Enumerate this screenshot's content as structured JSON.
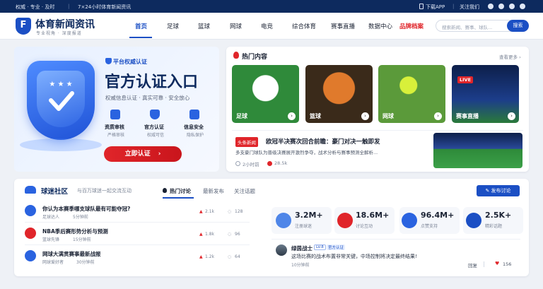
{
  "topbar": {
    "slogan": "权威 · 专业 · 及时",
    "news": "7×24小时体育新闻资讯",
    "download": "下载APP",
    "follow": "关注我们"
  },
  "brand": {
    "name": "体育新闻资讯",
    "tagline": "专业视角 · 深度报道",
    "logo_char": "F"
  },
  "nav": {
    "items": [
      "首页",
      "足球",
      "篮球",
      "网球",
      "电竞",
      "综合体育",
      "赛事直播",
      "数据中心",
      "品牌档案"
    ],
    "active_index": 0,
    "search_placeholder": "搜索新闻、赛事、球队...",
    "search_btn": "搜索"
  },
  "hero": {
    "tag": "平台权威认证",
    "title": "官方认证入口",
    "subtitle": "权威信息认证 · 真实可靠 · 安全放心",
    "features": [
      {
        "label": "资质审核",
        "sub": "严格审核"
      },
      {
        "label": "官方认证",
        "sub": "权威可信"
      },
      {
        "label": "信息安全",
        "sub": "隐私保护"
      }
    ],
    "cta": "立即认证",
    "cta_arrow": "›"
  },
  "hot": {
    "title": "热门内容",
    "more": "查看更多 ›",
    "tiles": [
      {
        "label": "足球",
        "color": "#2f8a3a"
      },
      {
        "label": "篮球",
        "color": "#b4551a"
      },
      {
        "label": "网球",
        "color": "#4c8f2a"
      },
      {
        "label": "赛事直播",
        "color": "#1c3d8a",
        "badge": "LIVE"
      }
    ],
    "headline": {
      "tag": "头条新闻",
      "title": "欧冠半决赛次回合前瞻：豪门对决一触即发",
      "summary": "多支豪门球队为晋级决赛展开激烈争夺，战术分析与赛事预测全解析...",
      "time": "2小时前",
      "views": "28.5k"
    }
  },
  "community": {
    "title": "球迷社区",
    "subtitle": "与百万球迷一起交流互动",
    "tabs": [
      "热门讨论",
      "最新发布",
      "关注话题"
    ],
    "active_tab": 0,
    "post_btn": "发布讨论",
    "topics": [
      {
        "title": "你认为本赛季哪支球队最有可能夺冠?",
        "author": "足球达人",
        "time": "5分钟前",
        "hot": "2.1k",
        "replies": "128",
        "color": "#2a63e0"
      },
      {
        "title": "NBA季后赛形势分析与预测",
        "author": "篮球先锋",
        "time": "15分钟前",
        "hot": "1.8k",
        "replies": "96",
        "color": "#e0252a"
      },
      {
        "title": "网球大满贯赛事最新战报",
        "author": "网球爱好者",
        "time": "30分钟前",
        "hot": "1.2k",
        "replies": "64",
        "color": "#2a63e0"
      }
    ],
    "stats": [
      {
        "value": "3.2M+",
        "label": "注册球迷",
        "color": "#4f86e8"
      },
      {
        "value": "18.6M+",
        "label": "讨论互动",
        "color": "#e0252a"
      },
      {
        "value": "96.4M+",
        "label": "点赞支持",
        "color": "#2a63e0"
      },
      {
        "value": "2.5K+",
        "label": "精彩话题",
        "color": "#1b4fc4"
      }
    ],
    "comment": {
      "user": "绿茵战士",
      "level": "LV.8",
      "badge": "官方认证",
      "text": "这场比赛的战术布置非常关键，中场控制将决定最终结果!",
      "time": "10分钟前",
      "reply": "回复",
      "likes": "156"
    }
  },
  "colors": {
    "brand": "#1b4fc4",
    "accent": "#e0252a",
    "dark": "#0d2a5e"
  }
}
